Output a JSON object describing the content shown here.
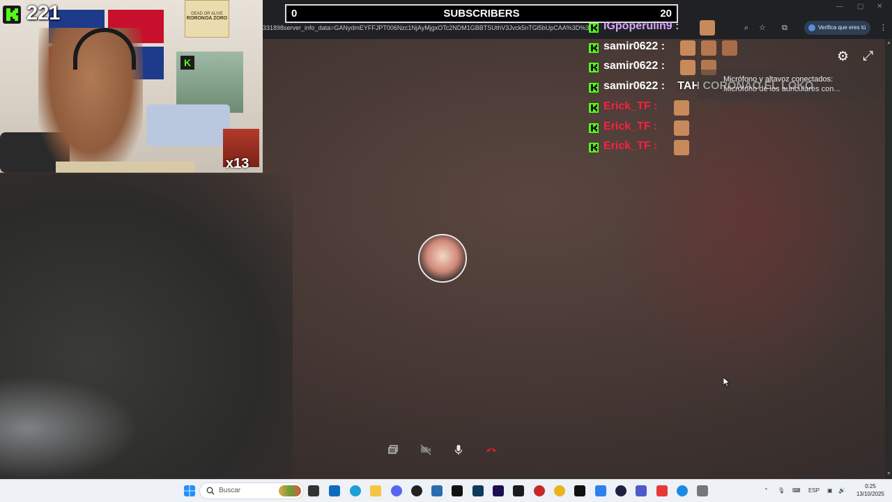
{
  "browser": {
    "url_fragment": "331898server_info_data=GANydmEYFFJPT006Nzc1NjAyMjgxOTc2NDM1GBBTSUthV3Jvck5nTGl5bUpCAA%3D%3D",
    "verify_label": "Verifica que eres tú"
  },
  "stream": {
    "viewer_count": "221",
    "emote_multiplier": "x13",
    "poster_top": "DEAD OR ALIVE",
    "poster_name": "RORONOA ZORO"
  },
  "subscribers": {
    "current": "0",
    "label": "SUBSCRIBERS",
    "goal": "20"
  },
  "chat": [
    {
      "user": "IGpoperulin9 :",
      "message": "",
      "color": "#d9a6ff",
      "emotes": 1
    },
    {
      "user": "samir0622 :",
      "message": "",
      "color": "#ffffff",
      "emotes": 3
    },
    {
      "user": "samir0622 :",
      "message": "",
      "color": "#ffffff",
      "emotes": 2
    },
    {
      "user": "samir0622 :",
      "message": "TAH CORONAO EL LOKO",
      "color": "#ffffff",
      "emotes": 0
    },
    {
      "user": "Erick_TF :",
      "message": "",
      "color": "#ff1f3f",
      "emotes": 1
    },
    {
      "user": "Erick_TF :",
      "message": "",
      "color": "#ff1f3f",
      "emotes": 1
    },
    {
      "user": "Erick_TF :",
      "message": "",
      "color": "#ff1f3f",
      "emotes": 1
    }
  ],
  "notification": {
    "line1": "Micrófono y altavoz conectados:",
    "line2": "Micrófono de los auriculares con..."
  },
  "taskbar": {
    "search_placeholder": "Buscar",
    "language": "ESP",
    "time": "0:25",
    "date": "13/10/2025"
  },
  "colors": {
    "kick_green": "#53fc18",
    "end_call_red": "#e0202a"
  }
}
